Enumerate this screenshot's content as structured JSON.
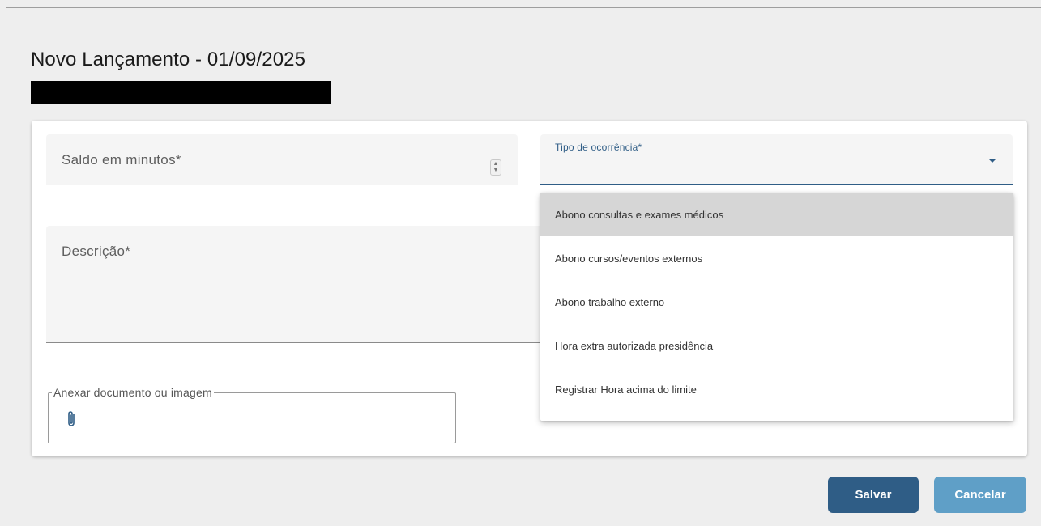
{
  "page": {
    "title": "Novo Lançamento - 01/09/2025"
  },
  "form": {
    "saldo_label": "Saldo em minutos*",
    "tipo_label": "Tipo de ocorrência*",
    "descricao_label": "Descrição*",
    "anexo_label": "Anexar documento ou imagem"
  },
  "dropdown": {
    "options": [
      "Abono consultas e exames médicos",
      "Abono cursos/eventos externos",
      "Abono trabalho externo",
      "Hora extra autorizada presidência",
      "Registrar Hora acima do limite"
    ],
    "highlighted_index": 0
  },
  "actions": {
    "save_label": "Salvar",
    "cancel_label": "Cancelar"
  },
  "colors": {
    "primary": "#2f5d86",
    "secondary": "#5f9fc7",
    "background": "#eeeeee",
    "highlight": "#d6d6d6"
  },
  "icons": {
    "attach": "paperclip-icon",
    "spinner": "number-spinner-icon",
    "dropdown": "caret-down-icon"
  }
}
